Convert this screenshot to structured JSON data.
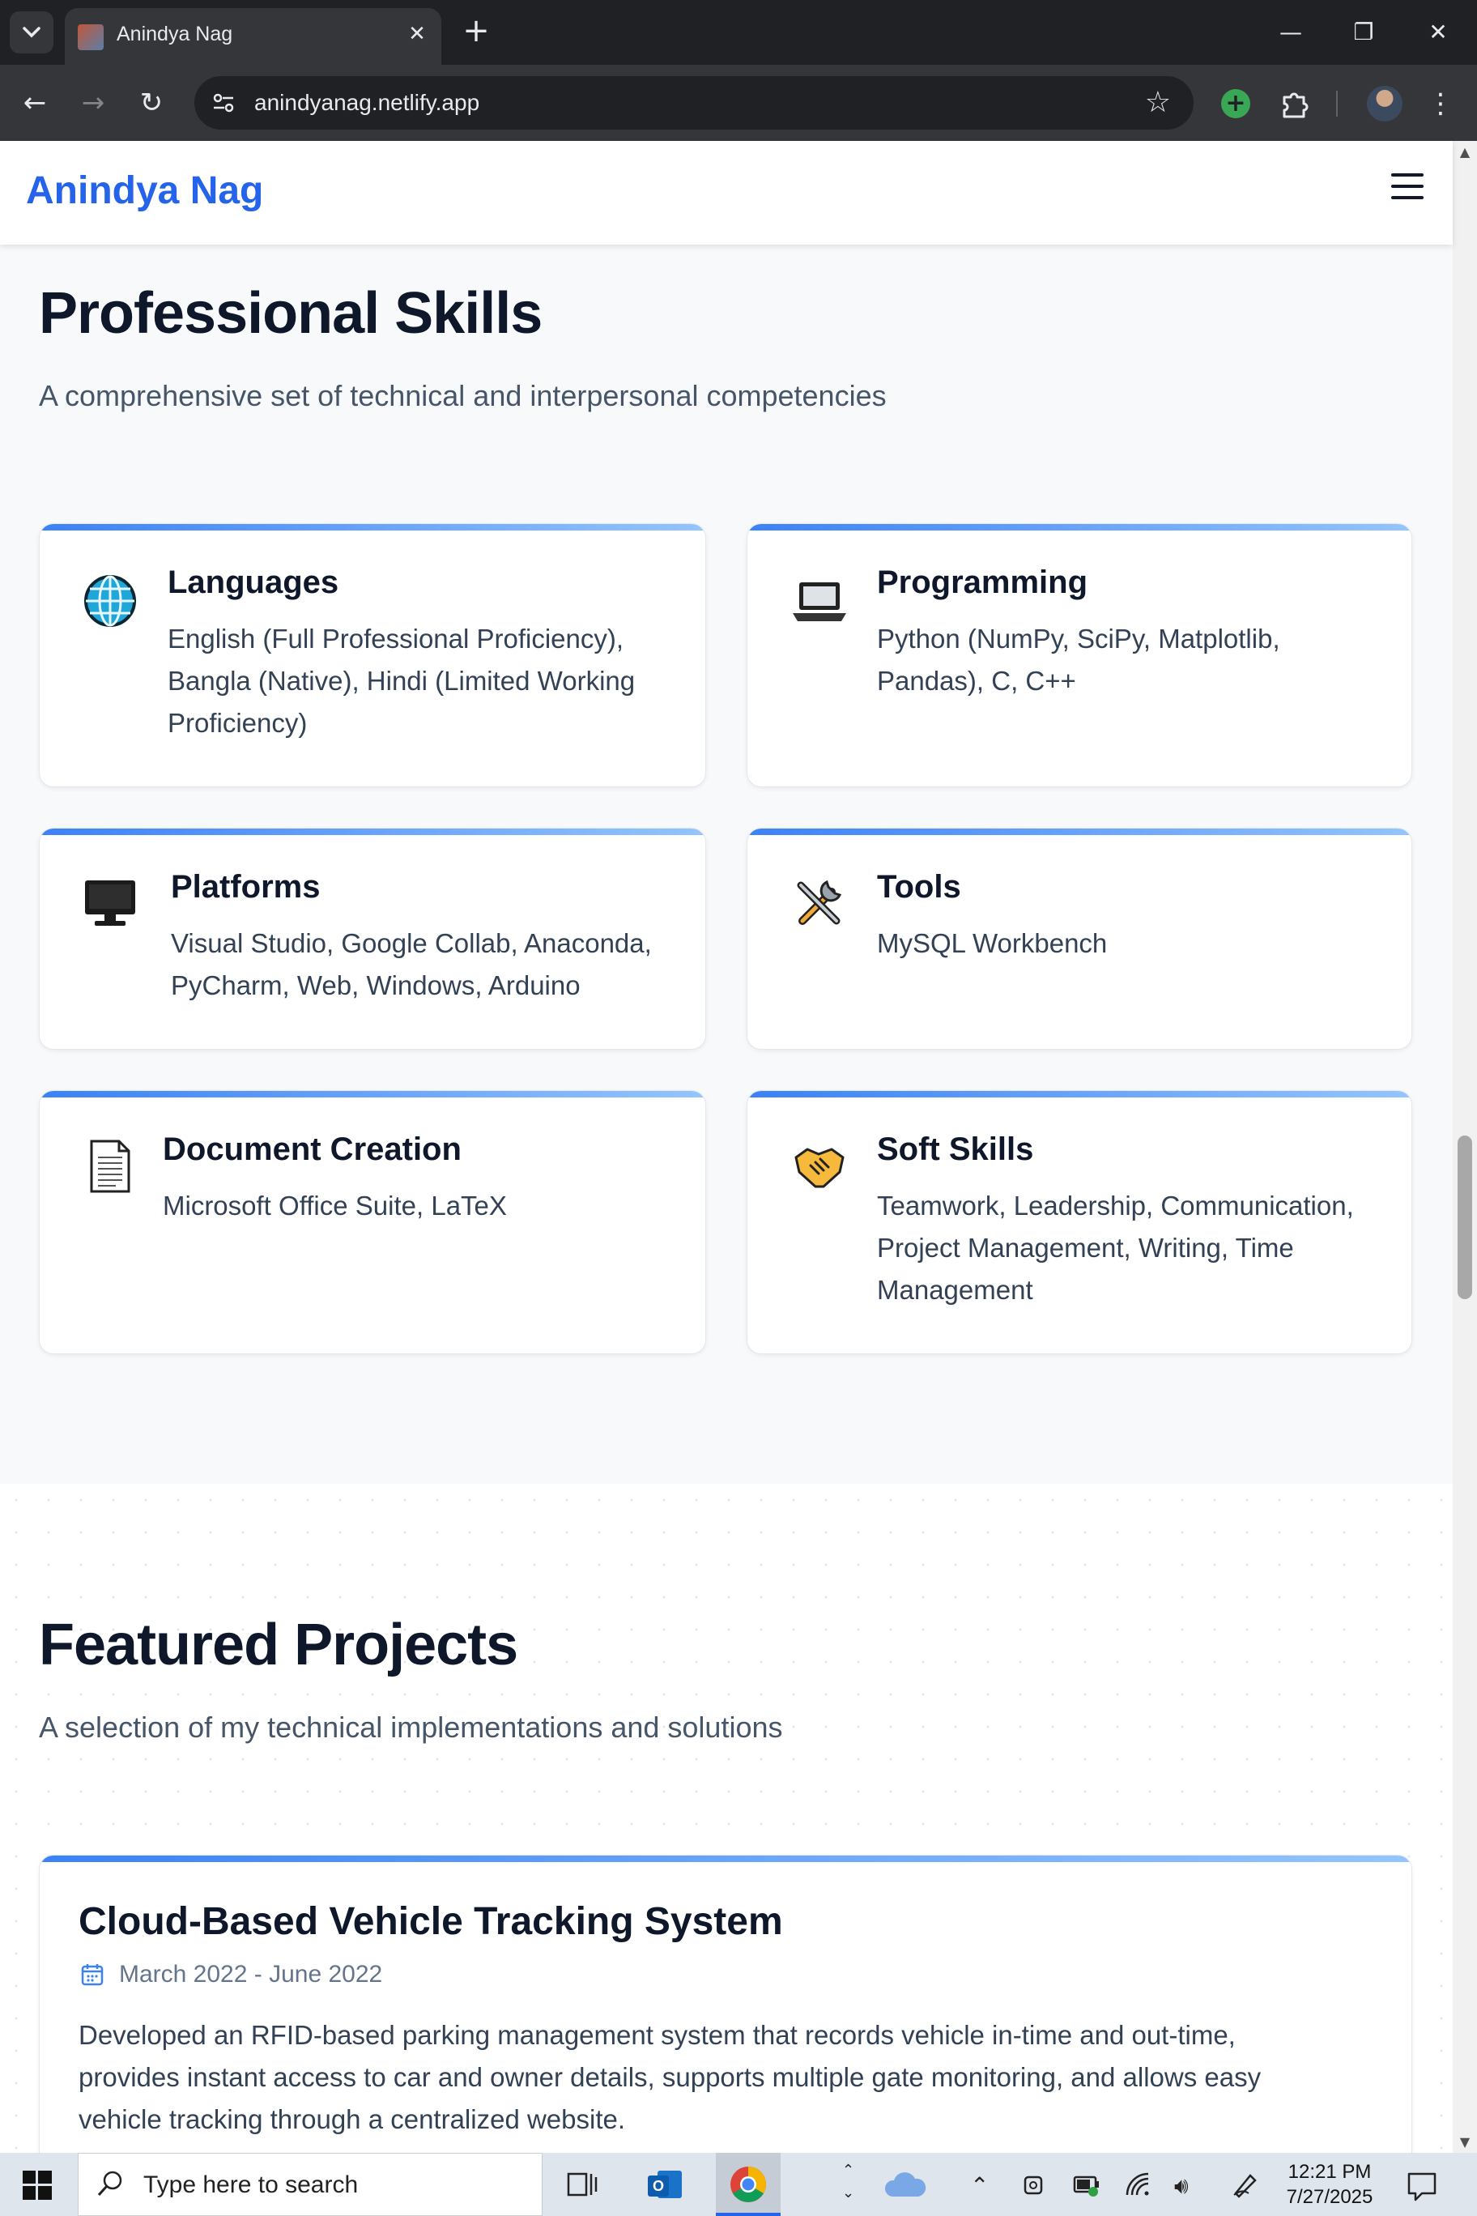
{
  "browser": {
    "tab_title": "Anindya Nag",
    "tab_close": "✕",
    "new_tab": "+",
    "url": "anindyanag.netlify.app",
    "window_controls": {
      "minimize": "—",
      "restore": "❐",
      "close": "✕"
    },
    "nav": {
      "back": "←",
      "forward": "→",
      "reload": "↻"
    },
    "star": "☆",
    "menu": "⋮"
  },
  "site": {
    "brand": "Anindya Nag",
    "skills": {
      "title": "Professional Skills",
      "subtitle": "A comprehensive set of technical and interpersonal competencies",
      "cards": [
        {
          "icon": "globe-icon",
          "title": "Languages",
          "lines": [
            "English (Full Professional Proficiency),",
            "Bangla (Native), Hindi (Limited Working",
            "Proficiency)"
          ]
        },
        {
          "icon": "laptop-icon",
          "title": "Programming",
          "lines": [
            "Python (NumPy, SciPy, Matplotlib,",
            "Pandas), C, C++"
          ]
        },
        {
          "icon": "monitor-icon",
          "title": "Platforms",
          "lines": [
            "Visual Studio, Google Collab, Anaconda,",
            "PyCharm, Web, Windows, Arduino"
          ]
        },
        {
          "icon": "tools-icon",
          "title": "Tools",
          "lines": [
            "MySQL Workbench"
          ]
        },
        {
          "icon": "document-icon",
          "title": "Document Creation",
          "lines": [
            "Microsoft Office Suite, LaTeX"
          ]
        },
        {
          "icon": "handshake-icon",
          "title": "Soft Skills",
          "lines": [
            "Teamwork, Leadership, Communication,",
            "Project Management, Writing, Time",
            "Management"
          ]
        }
      ]
    },
    "projects": {
      "title": "Featured Projects",
      "subtitle": "A selection of my technical implementations and solutions",
      "items": [
        {
          "title": "Cloud-Based Vehicle Tracking System",
          "date": "March 2022 - June 2022",
          "lines": [
            "Developed an RFID-based parking management system that records vehicle in-time and out-time,",
            "provides instant access to car and owner details, supports multiple gate monitoring, and allows easy",
            "vehicle tracking through a centralized website."
          ]
        }
      ]
    }
  },
  "taskbar": {
    "search_placeholder": "Type here to search",
    "time": "12:21 PM",
    "date": "7/27/2025"
  }
}
